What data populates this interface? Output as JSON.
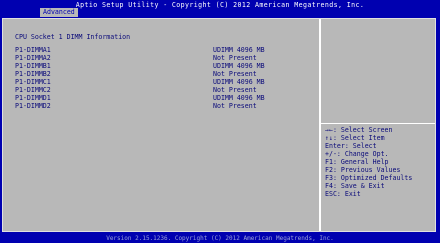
{
  "header": {
    "title": "Aptio Setup Utility - Copyright (C) 2012 American Megatrends, Inc.",
    "tab": "Advanced"
  },
  "main": {
    "section_title": "CPU Socket 1 DIMM Information",
    "rows": [
      {
        "label": "P1-DIMMA1",
        "value": "UDIMM  4096 MB"
      },
      {
        "label": "P1-DIMMA2",
        "value": "Not Present"
      },
      {
        "label": "P1-DIMMB1",
        "value": "UDIMM  4096 MB"
      },
      {
        "label": "P1-DIMMB2",
        "value": "Not Present"
      },
      {
        "label": "P1-DIMMC1",
        "value": "UDIMM  4096 MB"
      },
      {
        "label": "P1-DIMMC2",
        "value": "Not Present"
      },
      {
        "label": "P1-DIMMD1",
        "value": "UDIMM  4096 MB"
      },
      {
        "label": "P1-DIMMD2",
        "value": "Not Present"
      }
    ]
  },
  "help": [
    "→←: Select Screen",
    "↑↓: Select Item",
    "Enter: Select",
    "+/-: Change Opt.",
    "F1: General Help",
    "F2: Previous Values",
    "F3: Optimized Defaults",
    "F4: Save & Exit",
    "ESC: Exit"
  ],
  "footer": "Version 2.15.1236. Copyright (C) 2012 American Megatrends, Inc."
}
